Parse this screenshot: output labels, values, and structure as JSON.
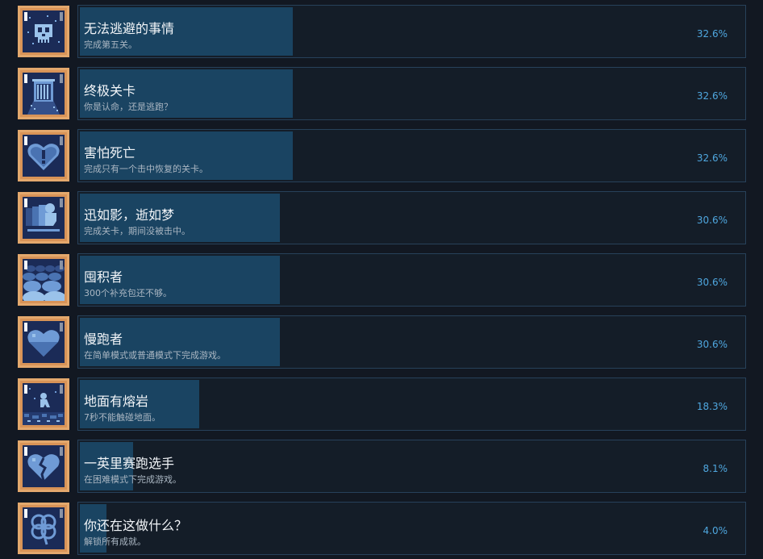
{
  "theme": {
    "background": "#121822",
    "frame": "#d89357",
    "icon_bg": "#1b2b57",
    "bar": "#1a4462",
    "percent_color": "#4fa7df"
  },
  "achievements": [
    {
      "icon": "skull-icon",
      "title": "无法逃避的事情",
      "description": "完成第五关。",
      "percent": "32.6%",
      "rate": 0.326
    },
    {
      "icon": "gate-icon",
      "title": "终极关卡",
      "description": "你是认命，还是逃跑？",
      "percent": "32.6%",
      "rate": 0.326
    },
    {
      "icon": "heart-exclamation-icon",
      "title": "害怕死亡",
      "description": "完成只有一个击中恢复的关卡。",
      "percent": "32.6%",
      "rate": 0.326
    },
    {
      "icon": "speeding-runner-icon",
      "title": "迅如影，逝如梦",
      "description": "完成关卡，期间没被击中。",
      "percent": "30.6%",
      "rate": 0.306
    },
    {
      "icon": "stacked-packs-icon",
      "title": "囤积者",
      "description": "300个补充包还不够。",
      "percent": "30.6%",
      "rate": 0.306
    },
    {
      "icon": "heart-icon",
      "title": "慢跑者",
      "description": "在简单模式或普通模式下完成游戏。",
      "percent": "30.6%",
      "rate": 0.306
    },
    {
      "icon": "lava-floor-icon",
      "title": "地面有熔岩",
      "description": "7秒不能触碰地面。",
      "percent": "18.3%",
      "rate": 0.183
    },
    {
      "icon": "cracked-heart-icon",
      "title": "一英里赛跑选手",
      "description": "在困难模式下完成游戏。",
      "percent": "8.1%",
      "rate": 0.081
    },
    {
      "icon": "clover-icon",
      "title": "你还在这做什么？",
      "description": "解锁所有成就。",
      "percent": "4.0%",
      "rate": 0.04
    }
  ]
}
